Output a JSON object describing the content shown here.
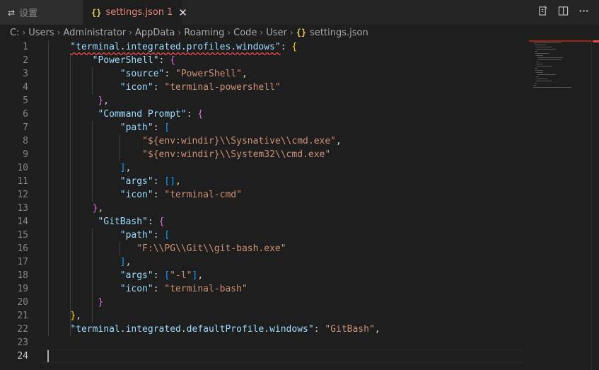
{
  "tabs": [
    {
      "label": "设置",
      "icon": "settings-sliders-icon"
    },
    {
      "label": "settings.json",
      "problems": "1",
      "icon": "json-braces-icon",
      "active": true
    }
  ],
  "tab_actions": [
    "open-settings-icon",
    "split-editor-icon",
    "more-actions-icon"
  ],
  "breadcrumb": [
    "C:",
    "Users",
    "Administrator",
    "AppData",
    "Roaming",
    "Code",
    "User",
    "settings.json"
  ],
  "line_numbers": [
    "1",
    "2",
    "3",
    "4",
    "5",
    "6",
    "7",
    "8",
    "9",
    "10",
    "11",
    "12",
    "13",
    "14",
    "15",
    "16",
    "17",
    "18",
    "19",
    "20",
    "21",
    "22",
    "23",
    "24"
  ],
  "code": {
    "profiles_key": "\"terminal.integrated.profiles.windows\"",
    "powershell_key": "\"PowerShell\"",
    "source_key": "\"source\"",
    "source_val": "\"PowerShell\"",
    "icon_key": "\"icon\"",
    "powershell_icon": "\"terminal-powershell\"",
    "cmd_key": "\"Command Prompt\"",
    "path_key": "\"path\"",
    "cmd_path1": "\"${env:windir}\\\\Sysnative\\\\cmd.exe\"",
    "cmd_path2": "\"${env:windir}\\\\System32\\\\cmd.exe\"",
    "args_key": "\"args\"",
    "cmd_icon": "\"terminal-cmd\"",
    "gitbash_key": "\"GitBash\"",
    "git_path": "\"F:\\\\PG\\\\Git\\\\git-bash.exe\"",
    "git_args": "\"-l\"",
    "git_icon": "\"terminal-bash\"",
    "default_key": "\"terminal.integrated.defaultProfile.windows\"",
    "default_val": "\"GitBash\""
  },
  "colors": {
    "key": "#9cdcfe",
    "string": "#ce9178",
    "bracket_level1": "#ffd700",
    "bracket_level2": "#da70d6",
    "bracket_level3": "#179fff",
    "active_tab_text": "#e2847a",
    "error": "#f14c4c"
  }
}
